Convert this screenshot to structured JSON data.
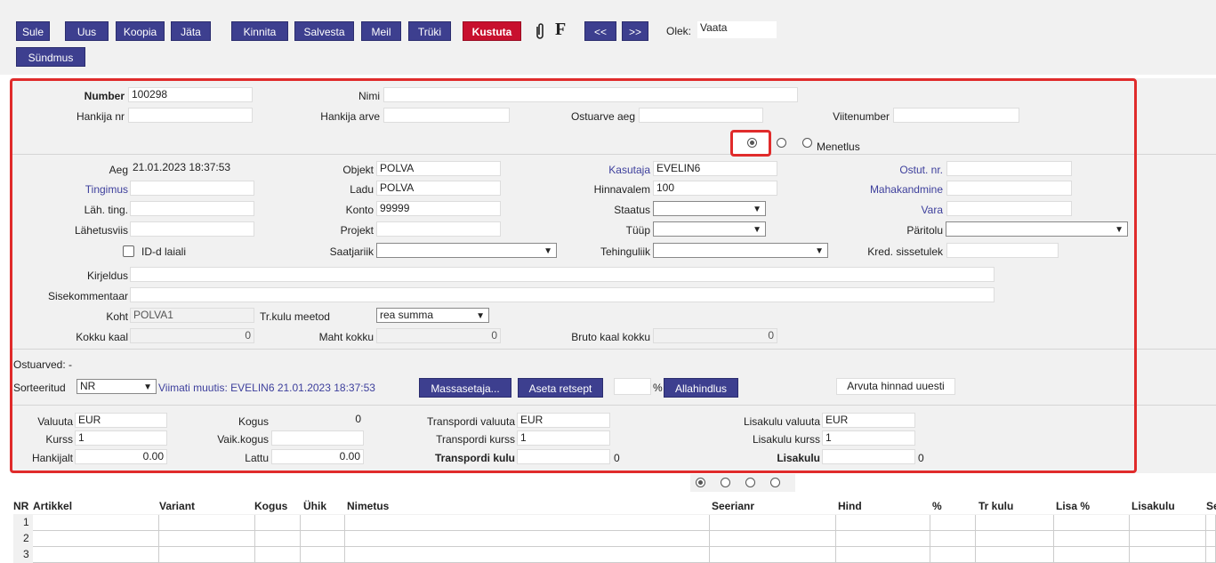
{
  "toolbar": {
    "buttons": [
      "Sule",
      "Uus",
      "Koopia",
      "Jäta",
      "Kinnita",
      "Salvesta",
      "Meil",
      "Trüki",
      "Kustuta"
    ],
    "attach_icon": "paperclip-icon",
    "f_label": "F",
    "prev": "<<",
    "next": ">>",
    "state_label": "Olek:",
    "state_value": "Vaata",
    "event_button": "Sündmus"
  },
  "header": {
    "number_label": "Number",
    "number_value": "100298",
    "name_label": "Nimi",
    "name_value": "",
    "supplier_nr_label": "Hankija nr",
    "supplier_invoice_label": "Hankija arve",
    "invoice_date_label": "Ostuarve aeg",
    "reference_label": "Viitenumber",
    "procedure_label": "Menetlus"
  },
  "details": {
    "time_label": "Aeg",
    "time_value": "21.01.2023 18:37:53",
    "object_label": "Objekt",
    "object_value": "POLVA",
    "user_label": "Kasutaja",
    "user_value": "EVELIN6",
    "purchase_nr_label": "Ostut. nr.",
    "condition_label": "Tingimus",
    "warehouse_label": "Ladu",
    "warehouse_value": "POLVA",
    "price_formula_label": "Hinnavalem",
    "price_formula_value": "100",
    "writeoff_label": "Mahakandmine",
    "send_cond_label": "Läh. ting.",
    "account_label": "Konto",
    "account_value": "99999",
    "status_label": "Staatus",
    "asset_label": "Vara",
    "shipping_label": "Lähetusviis",
    "project_label": "Projekt",
    "type_label": "Tüüp",
    "origin_label": "Päritolu",
    "ids_wide_label": "ID-d laiali",
    "sender_country_label": "Saatjariik",
    "transaction_type_label": "Tehinguliik",
    "credit_income_label": "Kred. sissetulek",
    "description_label": "Kirjeldus",
    "internal_comment_label": "Sisekommentaar",
    "location_label": "Koht",
    "location_value": "POLVA1",
    "tr_cost_method_label": "Tr.kulu meetod",
    "tr_cost_method_value": "rea summa",
    "total_weight_label": "Kokku kaal",
    "total_weight_value": "0",
    "total_volume_label": "Maht kokku",
    "total_volume_value": "0",
    "gross_weight_label": "Bruto kaal kokku",
    "gross_weight_value": "0"
  },
  "middle": {
    "invoices_text": "Ostuarved: -",
    "sorted_label": "Sorteeritud",
    "sorted_value": "NR",
    "last_change": "Viimati muutis: EVELIN6 21.01.2023 18:37:53",
    "mass_setter_button": "Massasetaja...",
    "set_recipe_button": "Aseta retsept",
    "percent_sign": "%",
    "discount_button": "Allahindlus",
    "recalc_button": "Arvuta hinnad uuesti"
  },
  "totals": {
    "currency_label": "Valuuta",
    "currency_value": "EUR",
    "rate_label": "Kurss",
    "rate_value": "1",
    "from_supplier_label": "Hankijalt",
    "from_supplier_value": "0.00",
    "qty_label": "Kogus",
    "qty_value": "0",
    "wait_qty_label": "Vaik.kogus",
    "to_stock_label": "Lattu",
    "to_stock_value": "0.00",
    "transport_currency_label": "Transpordi valuuta",
    "transport_currency_value": "EUR",
    "transport_rate_label": "Transpordi kurss",
    "transport_rate_value": "1",
    "transport_cost_label": "Transpordi kulu",
    "transport_cost_value": "0",
    "extra_currency_label": "Lisakulu valuuta",
    "extra_currency_value": "EUR",
    "extra_rate_label": "Lisakulu kurss",
    "extra_rate_value": "1",
    "extra_cost_label": "Lisakulu",
    "extra_cost_value": "0"
  },
  "table": {
    "columns": [
      "NR",
      "Artikkel",
      "Variant",
      "Kogus",
      "Ühik",
      "Nimetus",
      "Seerianr",
      "Hind",
      "%",
      "Tr kulu",
      "Lisa %",
      "Lisakulu",
      "Se"
    ],
    "rows": [
      "1",
      "2",
      "3"
    ]
  },
  "colors": {
    "button": "#3d3f8f",
    "danger": "#c8102e",
    "highlight": "#e02b2b",
    "link": "#3d3f9c"
  }
}
